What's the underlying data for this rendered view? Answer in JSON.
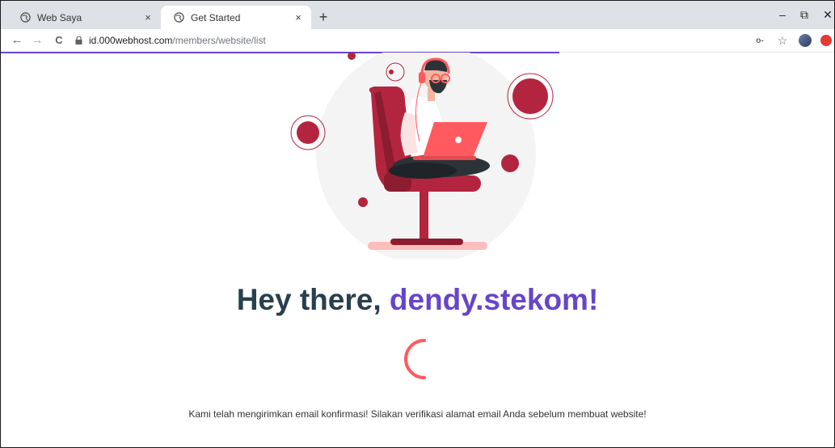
{
  "browser": {
    "tabs": [
      {
        "title": "Web Saya",
        "active": false,
        "icon": "globe-icon"
      },
      {
        "title": "Get Started",
        "active": true,
        "icon": "globe-icon"
      }
    ],
    "close_symbol": "×",
    "new_tab_symbol": "+",
    "window_controls": {
      "minimize": "–",
      "restore": "⧉",
      "close": "✕"
    },
    "nav": {
      "back": "←",
      "forward": "→",
      "reload": "C"
    },
    "url_host": "id.000webhost.com",
    "url_path": "/members/website/list",
    "star": "☆",
    "key_icon": "o-",
    "load_progress": 0.67
  },
  "page": {
    "greeting_prefix": "Hey there, ",
    "username": "dendy.stekom!",
    "message": "Kami telah mengirimkan email konfirmasi! Silakan verifikasi alamat email Anda sebelum membuat website!"
  },
  "colors": {
    "accent": "#6745c9",
    "heading": "#293f4d",
    "spinner": "#ff5a5f",
    "chair": "#b3253f"
  }
}
